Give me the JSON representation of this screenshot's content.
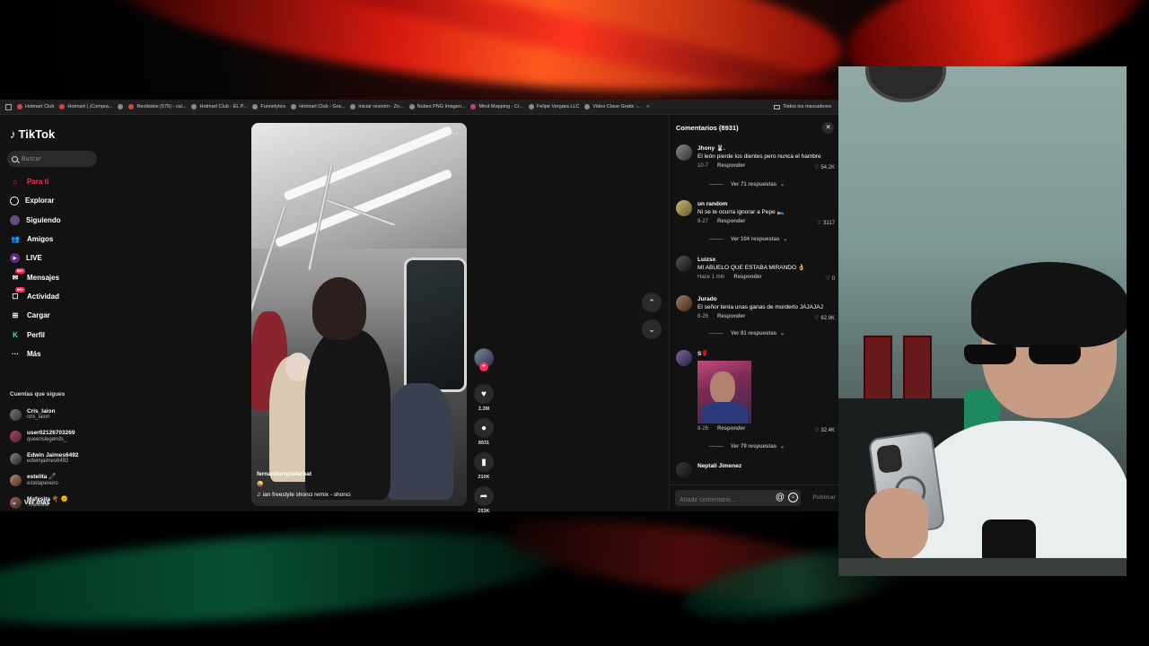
{
  "bookmarks": [
    {
      "label": "Hotmart Club",
      "icon": "hotmart-icon"
    },
    {
      "label": "Hotmart | ¡Compra...",
      "icon": "hotmart-icon"
    },
    {
      "label": "",
      "icon": "globe-icon"
    },
    {
      "label": "Recibidos (575) - cal...",
      "icon": "gmail-icon"
    },
    {
      "label": "Hotmart Club - EL P...",
      "icon": "globe-icon"
    },
    {
      "label": "Funnelytics",
      "icon": "globe-icon"
    },
    {
      "label": "Hotmart Club - Gra...",
      "icon": "globe-icon"
    },
    {
      "label": "Iniciar reunión - Zo...",
      "icon": "globe-icon"
    },
    {
      "label": "Nubes PNG Imagen...",
      "icon": "globe-icon"
    },
    {
      "label": "Mind Mapping - Cr...",
      "icon": "mindmap-icon"
    },
    {
      "label": "Felipe Vergara LLC",
      "icon": "globe-icon"
    },
    {
      "label": "Video Clase Gratis -...",
      "icon": "r-icon"
    }
  ],
  "bookmarks_all": "Todos los marcadores",
  "brand": {
    "name": "TikTok",
    "accent": "#fe2c55"
  },
  "search": {
    "placeholder": "Buscar"
  },
  "nav": [
    {
      "label": "Para ti",
      "icon": "home-icon",
      "active": true
    },
    {
      "label": "Explorar",
      "icon": "compass-icon"
    },
    {
      "label": "Siguiendo",
      "icon": "following-icon"
    },
    {
      "label": "Amigos",
      "icon": "friends-icon"
    },
    {
      "label": "LIVE",
      "icon": "live-icon"
    },
    {
      "label": "Mensajes",
      "icon": "messages-icon",
      "badge": "99+"
    },
    {
      "label": "Actividad",
      "icon": "activity-icon",
      "badge": "99+"
    },
    {
      "label": "Cargar",
      "icon": "upload-icon"
    },
    {
      "label": "Perfil",
      "icon": "profile-icon"
    },
    {
      "label": "Más",
      "icon": "more-icon"
    }
  ],
  "following": {
    "title": "Cuentas que sigues",
    "accounts": [
      {
        "name": "Cris_laion",
        "handle": "cris_laion"
      },
      {
        "name": "user02126703269",
        "handle": "queenslegends_"
      },
      {
        "name": "Edwin Jaimes6492",
        "handle": "edwinjaimes6492"
      },
      {
        "name": "estelita 🧷",
        "handle": "estelapereiro"
      },
      {
        "name": "Mafesita 🌴 🌞",
        "handle": ".mafesita"
      }
    ],
    "see_more": "Ver más"
  },
  "video": {
    "author": "fernandamptafarhat",
    "emoji": "😜",
    "music": "♫ ian freestyle shonci remix - shonci",
    "more": "···"
  },
  "actions": {
    "likes": "2.2M",
    "comments": "8931",
    "saves": "210K",
    "shares": "253K"
  },
  "comments": {
    "header": "Comentarios (8931)",
    "items": [
      {
        "user": "Jhony 🐰.",
        "text": "El león pierde los dientes pero nunca el hambre",
        "date": "10-7",
        "reply": "Responder",
        "likes": "54.2K",
        "more": "Ver 71 respuestas"
      },
      {
        "user": "un random",
        "text": "Ni se te ocurra ignorar a Pepe 🛌",
        "date": "8-27",
        "reply": "Responder",
        "likes": "3117",
        "more": "Ver 104 respuestas"
      },
      {
        "user": "Luizsx",
        "text": "MI ABUELO QUE ESTABA MIRANDO 👌",
        "date": "Hace 1 min",
        "reply": "Responder",
        "likes": "0",
        "more": ""
      },
      {
        "user": "Jurado",
        "text": "El señor tenía unas ganas de morderlo JAJAJAJ",
        "date": "8-26",
        "reply": "Responder",
        "likes": "62.9K",
        "more": "Ver 81 respuestas"
      },
      {
        "user": "S🌹",
        "text": "",
        "date": "8-26",
        "reply": "Responder",
        "likes": "32.4K",
        "more": "Ver 79 respuestas"
      },
      {
        "user": "Neptali Jimenez",
        "text": "",
        "date": "",
        "reply": "",
        "likes": "",
        "more": ""
      }
    ],
    "input_placeholder": "Añadir comentario...",
    "post": "Publicar"
  }
}
